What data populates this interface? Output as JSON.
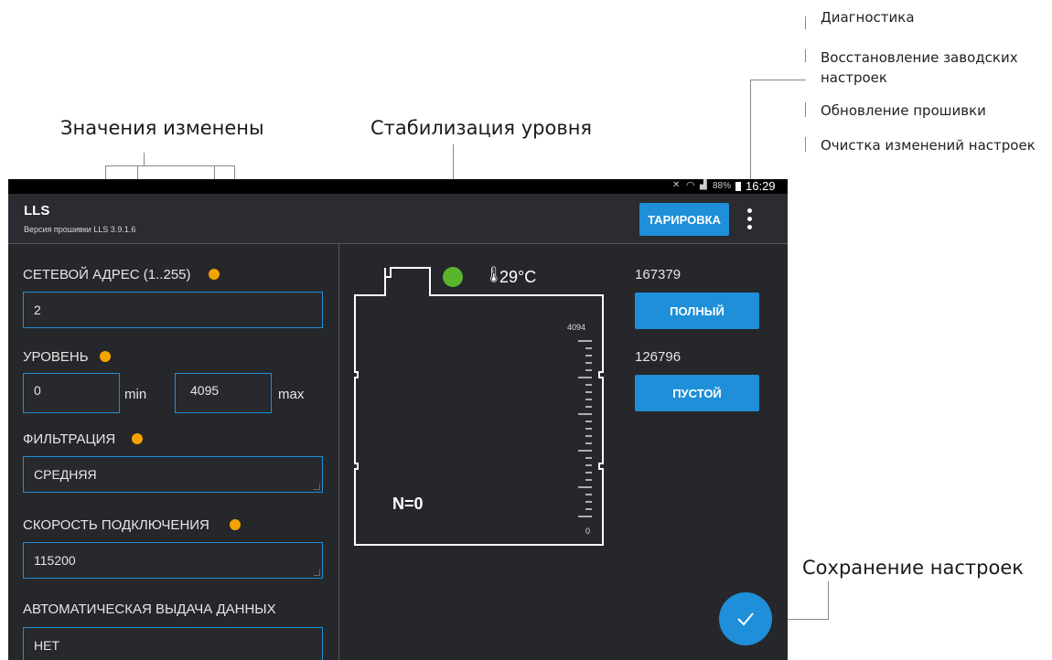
{
  "callouts": {
    "values_changed": "Значения изменены",
    "level_stabilization": "Стабилизация уровня",
    "save_settings": "Сохранение настроек"
  },
  "overflow_menu": {
    "items": [
      "Диагностика",
      "Восстановление заводских",
      "настроек",
      "Обновление прошивки",
      "Очистка изменений настроек"
    ]
  },
  "statusbar": {
    "battery": "88%",
    "time": "16:29"
  },
  "app": {
    "title": "LLS",
    "subtitle": "Версия прошивки LLS 3.9.1.6",
    "calibration_button": "ТАРИРОВКА"
  },
  "form": {
    "network_address": {
      "label": "СЕТЕВОЙ АДРЕС (1..255)",
      "value": "2"
    },
    "level": {
      "label": "УРОВЕНЬ",
      "min_value": "0",
      "min_label": "min",
      "max_value": "4095",
      "max_label": "max"
    },
    "filtering": {
      "label": "ФИЛЬТРАЦИЯ",
      "value": "СРЕДНЯЯ"
    },
    "connection_speed": {
      "label": "СКОРОСТЬ ПОДКЛЮЧЕНИЯ",
      "value": "115200"
    },
    "auto_output": {
      "label": "АВТОМАТИЧЕСКАЯ ВЫДАЧА ДАННЫХ",
      "value": "НЕТ"
    }
  },
  "tank": {
    "temperature": "29°C",
    "scale_max": "4094",
    "scale_min": "0",
    "n_value": "N=0",
    "stability_color": "#5ab52c"
  },
  "calibration": {
    "full_value": "167379",
    "full_button": "ПОЛНЫЙ",
    "empty_value": "126796",
    "empty_button": "ПУСТОЙ"
  },
  "colors": {
    "accent": "#1e8fd8",
    "changed_marker": "#f5a300",
    "background": "#25272b"
  }
}
